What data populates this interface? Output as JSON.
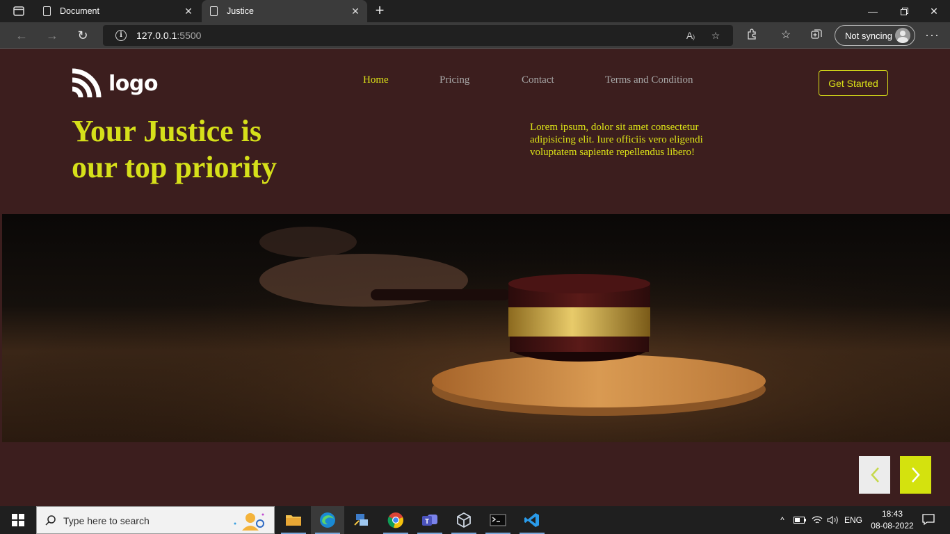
{
  "browser": {
    "tabs": [
      {
        "title": "Document"
      },
      {
        "title": "Justice"
      }
    ],
    "url_host": "127.0.0.1",
    "url_port": ":5500",
    "sync_label": "Not syncing"
  },
  "site": {
    "logo_text": "logo",
    "nav": [
      {
        "label": "Home",
        "active": true
      },
      {
        "label": "Pricing"
      },
      {
        "label": "Contact"
      },
      {
        "label": "Terms and Condition"
      }
    ],
    "cta_label": "Get Started",
    "hero_title": "Your Justice is our top priority",
    "hero_text": "Lorem ipsum, dolor sit amet consectetur adipisicing elit. Iure officiis vero eligendi voluptatem sapiente repellendus libero!",
    "colors": {
      "background": "#3c1e1e",
      "accent": "#dce318"
    }
  },
  "taskbar": {
    "search_placeholder": "Type here to search",
    "language": "ENG",
    "time": "18:43",
    "date": "08-08-2022"
  }
}
